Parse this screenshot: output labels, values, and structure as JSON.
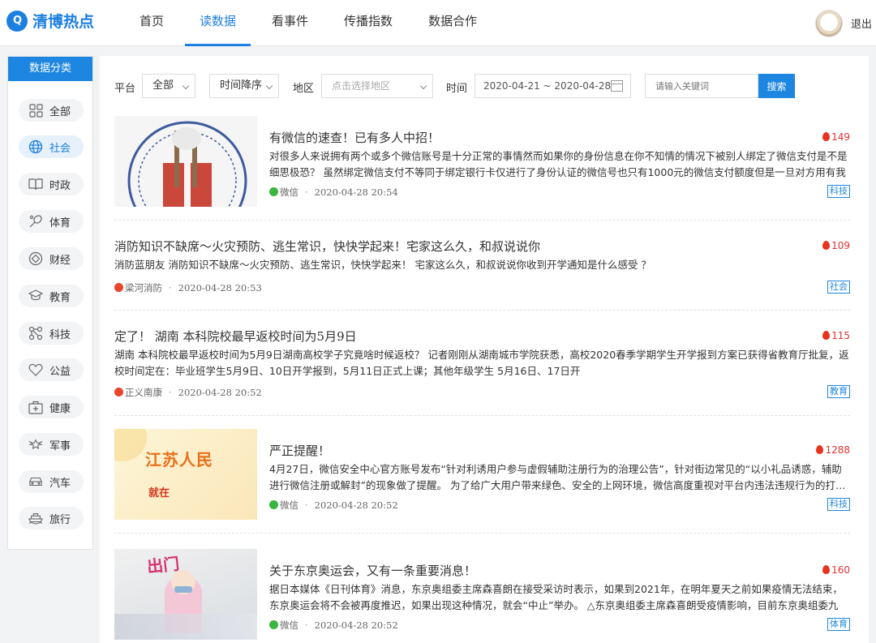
{
  "header": {
    "logo_text": "清博热点",
    "logo_mark": "Q",
    "nav": [
      {
        "label": "首页",
        "active": false
      },
      {
        "label": "读数据",
        "active": true
      },
      {
        "label": "看事件",
        "active": false
      },
      {
        "label": "传播指数",
        "active": false
      },
      {
        "label": "数据合作",
        "active": false
      }
    ],
    "logout": "退出"
  },
  "sidebar": {
    "title": "数据分类",
    "items": [
      {
        "label": "全部",
        "icon": "grid-icon",
        "active": false
      },
      {
        "label": "社会",
        "icon": "globe-icon",
        "active": true
      },
      {
        "label": "时政",
        "icon": "book-icon",
        "active": false
      },
      {
        "label": "体育",
        "icon": "racket-icon",
        "active": false
      },
      {
        "label": "财经",
        "icon": "diamond-icon",
        "active": false
      },
      {
        "label": "教育",
        "icon": "graduation-cap-icon",
        "active": false
      },
      {
        "label": "科技",
        "icon": "network-icon",
        "active": false
      },
      {
        "label": "公益",
        "icon": "heart-icon",
        "active": false
      },
      {
        "label": "健康",
        "icon": "medical-kit-icon",
        "active": false
      },
      {
        "label": "军事",
        "icon": "military-badge-icon",
        "active": false
      },
      {
        "label": "汽车",
        "icon": "car-icon",
        "active": false
      },
      {
        "label": "旅行",
        "icon": "ship-icon",
        "active": false
      }
    ]
  },
  "filters": {
    "platform_label": "平台",
    "platform_value": "全部",
    "sort_value": "时间降序",
    "region_label": "地区",
    "region_placeholder": "点击选择地区",
    "time_label": "时间",
    "date_range": "2020-04-21 ~ 2020-04-28",
    "search_placeholder": "请输入关键词",
    "search_button": "搜索"
  },
  "articles": [
    {
      "title": "有微信的速查！已有多人中招！",
      "heat": "149",
      "summary": "对很多人来说拥有两个或多个微信账号是十分正常的事情然而如果你的身份信息在你不知情的情况下被别人绑定了微信支付是不是细思极恐？ 虽然绑定微信支付不等同于绑定银行卡仅进行了身份认证的微信号也只有1000元的微信支付额度但是一旦对方用有我们…",
      "source": "微信",
      "source_icon": "wechat-icon",
      "time": "2020-04-28 20:54",
      "tag": "科技",
      "thumb": "seal-thumbnail"
    },
    {
      "title": "消防知识不缺席～火灾预防、逃生常识，快快学起来！宅家这么久，和叔说说你",
      "heat": "109",
      "summary": "消防蓝朋友 消防知识不缺席～火灾预防、逃生常识，快快学起来！ 宅家这么久，和叔说说你收到开学通知是什么感受 ？",
      "source": "梁河消防",
      "source_icon": "weibo-icon",
      "time": "2020-04-28 20:53",
      "tag": "社会"
    },
    {
      "title": "定了！ 湖南 本科院校最早返校时间为5月9日",
      "heat": "115",
      "summary": "湖南 本科院校最早返校时间为5月9日湖南高校学子究竟啥时候返校？ 记者刚刚从湖南城市学院获悉，高校2020春季学期学生开学报到方案已获得省教育厅批复，返校时间定在：毕业班学生5月9日、10日开学报到，5月11日正式上课；其他年级学生 5月16日、17日开",
      "source": "正义南康",
      "source_icon": "weibo-icon",
      "time": "2020-04-28 20:52",
      "tag": "教育"
    },
    {
      "title": "严正提醒！",
      "heat": "1288",
      "summary": "4月27日，微信安全中心官方账号发布“针对利诱用户参与虚假辅助注册行为的治理公告”，针对街边常见的“以小礼品诱惑，辅助进行微信注册或解封”的现象做了提醒。 为了给广大用户带来绿色、安全的上网环境，微信高度重视对平台内违法违规行为的打…",
      "source": "微信",
      "source_icon": "wechat-icon",
      "time": "2020-04-28 20:52",
      "tag": "科技",
      "thumb": "banner-thumbnail",
      "thumb_text_1": "江苏人民",
      "thumb_text_2": "就在"
    },
    {
      "title": "关于东京奥运会，又有一条重要消息！",
      "heat": "160",
      "summary": "据日本媒体《日刊体育》消息，东京奥组委主席森喜朗在接受采访时表示，如果到2021年，在明年夏天之前如果疫情无法结束，东京奥运会将不会被再度推迟，如果出现这种情况，就会“中止”举办。 △东京奥组委主席森喜朗受疫情影响，目前东京奥组委九成…",
      "source": "微信",
      "source_icon": "wechat-icon",
      "time": "2020-04-28 20:52",
      "tag": "体育",
      "thumb": "poster-thumbnail",
      "thumb_text_1": "出门"
    }
  ]
}
